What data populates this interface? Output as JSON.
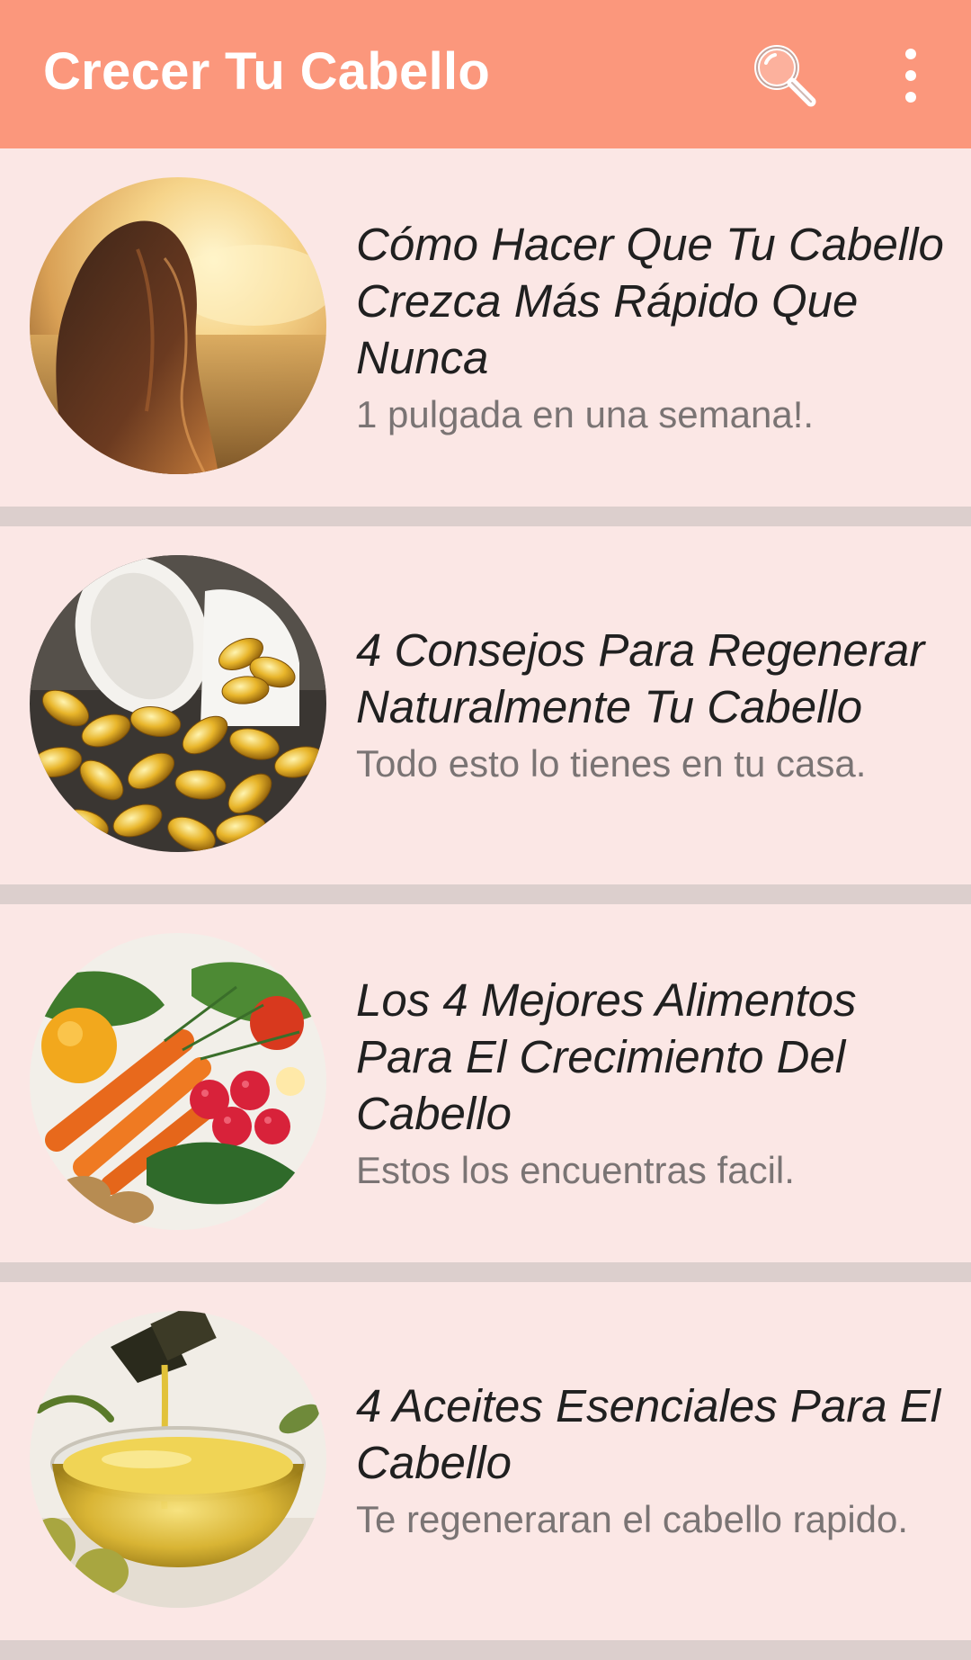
{
  "appbar": {
    "title": "Crecer Tu Cabello",
    "bg_color": "#fb977c",
    "actions": [
      {
        "icon": "search-icon"
      },
      {
        "icon": "more-vert-icon"
      }
    ]
  },
  "articles": [
    {
      "title": "Cómo Hacer Que Tu Cabello Crezca Más Rápido Que Nunca",
      "subtitle": "1 pulgada en una semana!.",
      "image": "woman-in-sunset-field-photo"
    },
    {
      "title": "4 Consejos Para Regenerar Naturalmente Tu Cabello",
      "subtitle": "Todo esto lo tienes en tu casa.",
      "image": "supplement-capsules-photo"
    },
    {
      "title": "Los 4 Mejores Alimentos Para El Crecimiento Del Cabello",
      "subtitle": "Estos los encuentras facil.",
      "image": "vegetables-and-berries-photo"
    },
    {
      "title": "4 Aceites Esenciales Para El Cabello",
      "subtitle": "Te regeneraran el cabello rapido.",
      "image": "olive-oil-bowl-photo"
    }
  ],
  "colors": {
    "card_bg": "#fbe7e5",
    "divider": "#dccfcd",
    "title_text": "#202020",
    "subtitle_text": "#7a7474"
  }
}
